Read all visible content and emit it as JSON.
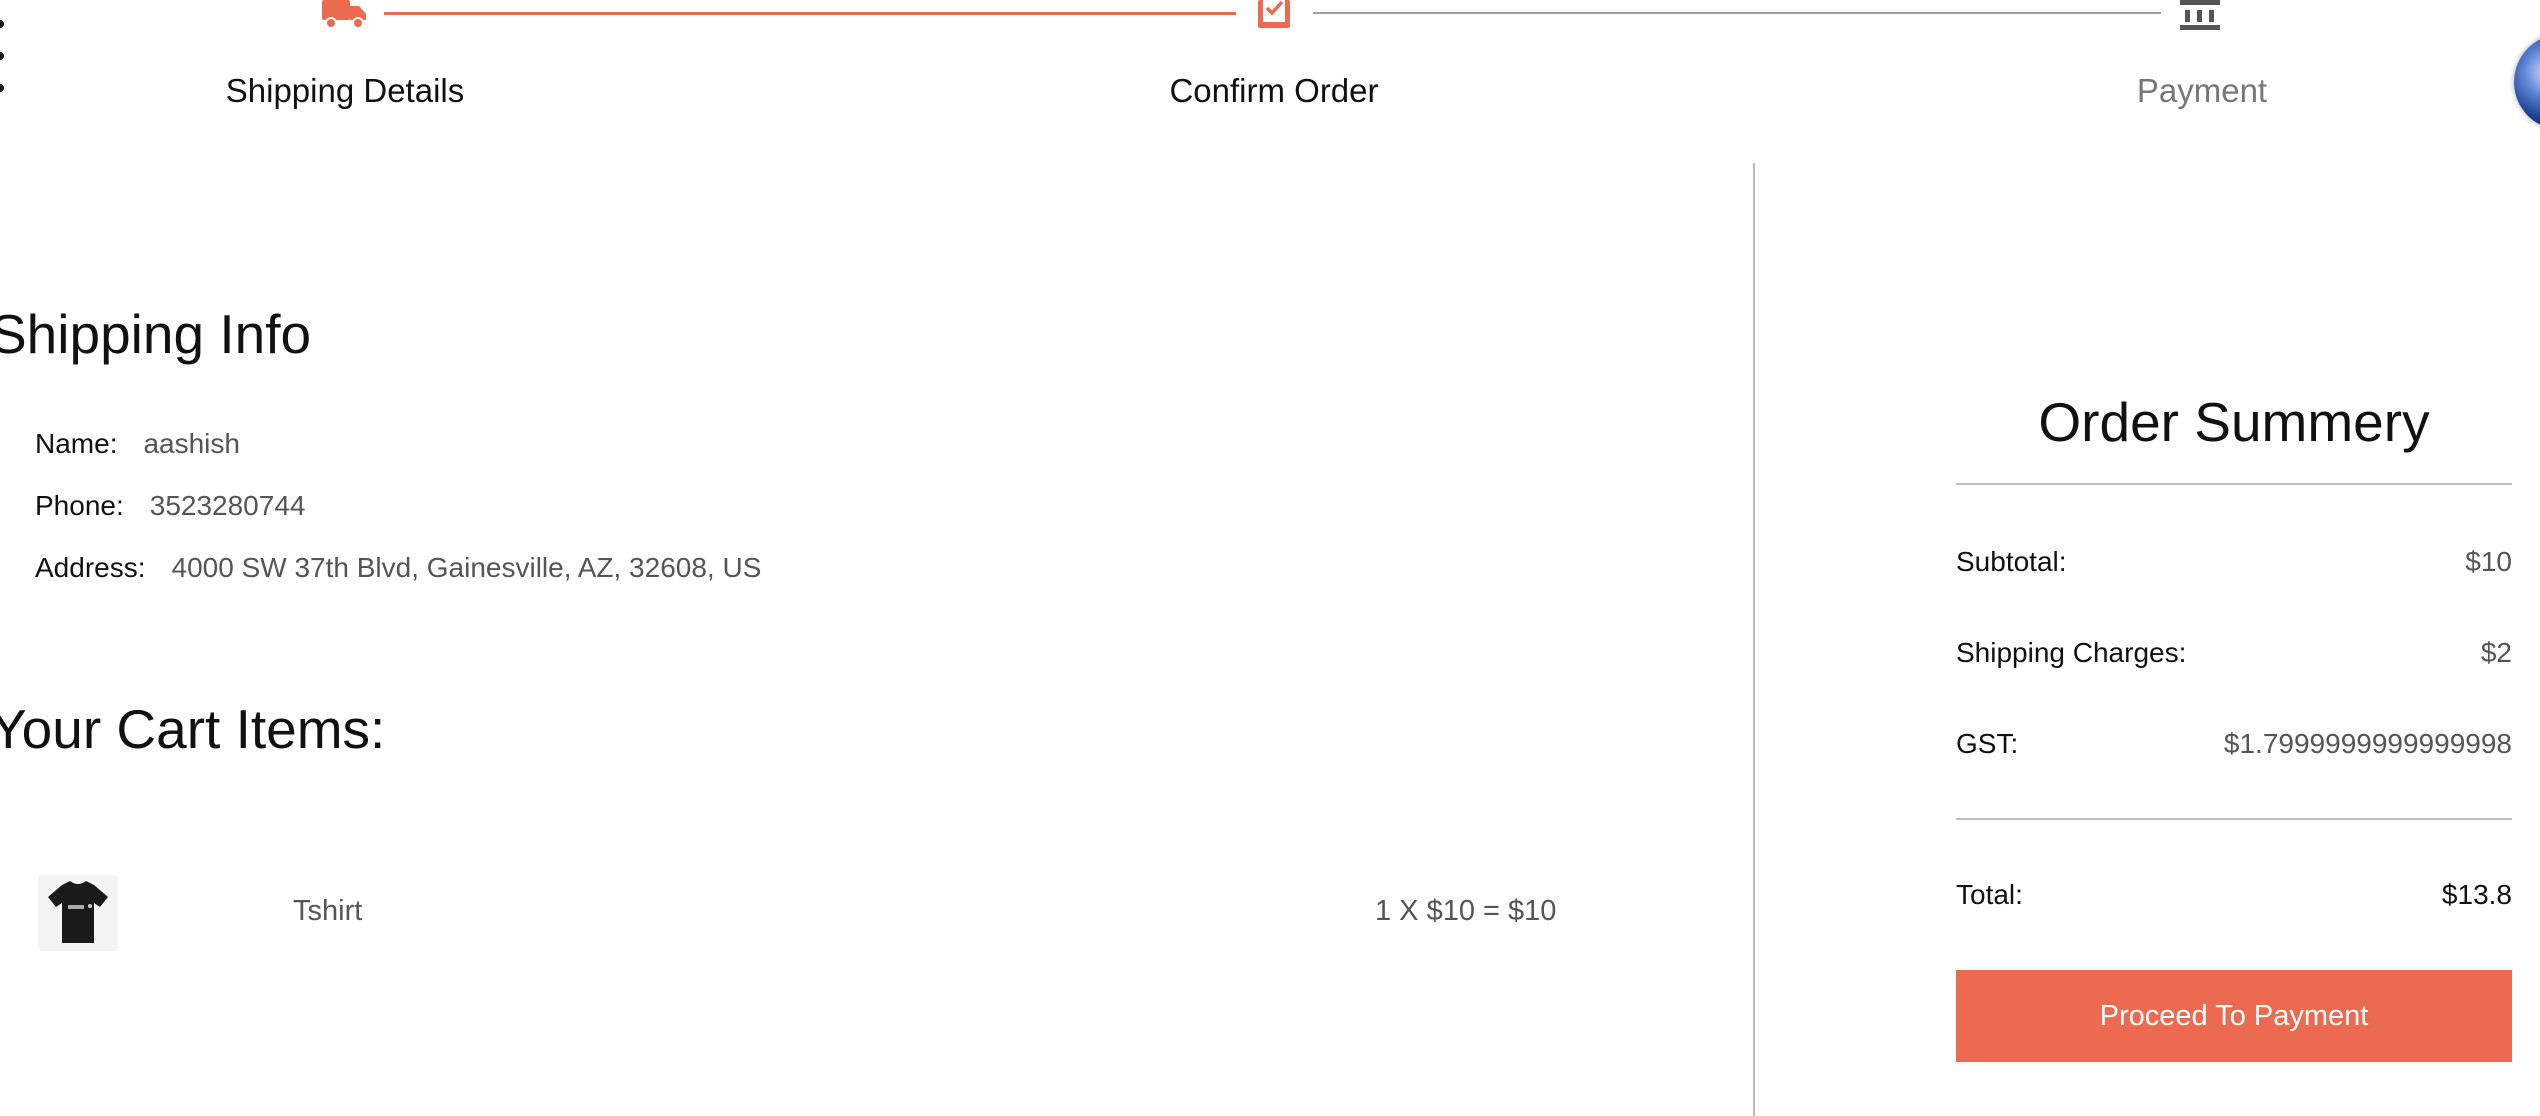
{
  "stepper": {
    "steps": [
      {
        "label": "Shipping Details",
        "icon": "truck-icon",
        "state": "completed"
      },
      {
        "label": "Confirm Order",
        "icon": "order-check-icon",
        "state": "active"
      },
      {
        "label": "Payment",
        "icon": "bank-icon",
        "state": "pending"
      }
    ],
    "active_color": "#eb6a50",
    "inactive_color": "#777777"
  },
  "shipping_info": {
    "title": "Shipping Info",
    "name_label": "Name:",
    "name_value": "aashish",
    "phone_label": "Phone:",
    "phone_value": "3523280744",
    "address_label": "Address:",
    "address_value": "4000 SW 37th Blvd, Gainesville, AZ, 32608, US"
  },
  "cart": {
    "title": "Your Cart Items:",
    "items": [
      {
        "name": "Tshirt",
        "price_line": "1 X $10 = $10",
        "image": "tshirt-thumbnail"
      }
    ]
  },
  "summary": {
    "title": "Order Summery",
    "subtotal_label": "Subtotal:",
    "subtotal_value": "$10",
    "shipping_label": "Shipping Charges:",
    "shipping_value": "$2",
    "gst_label": "GST:",
    "gst_value": "$1.7999999999999998",
    "total_label": "Total:",
    "total_value": "$13.8",
    "button_label": "Proceed To Payment",
    "button_color": "#eb6a50"
  }
}
